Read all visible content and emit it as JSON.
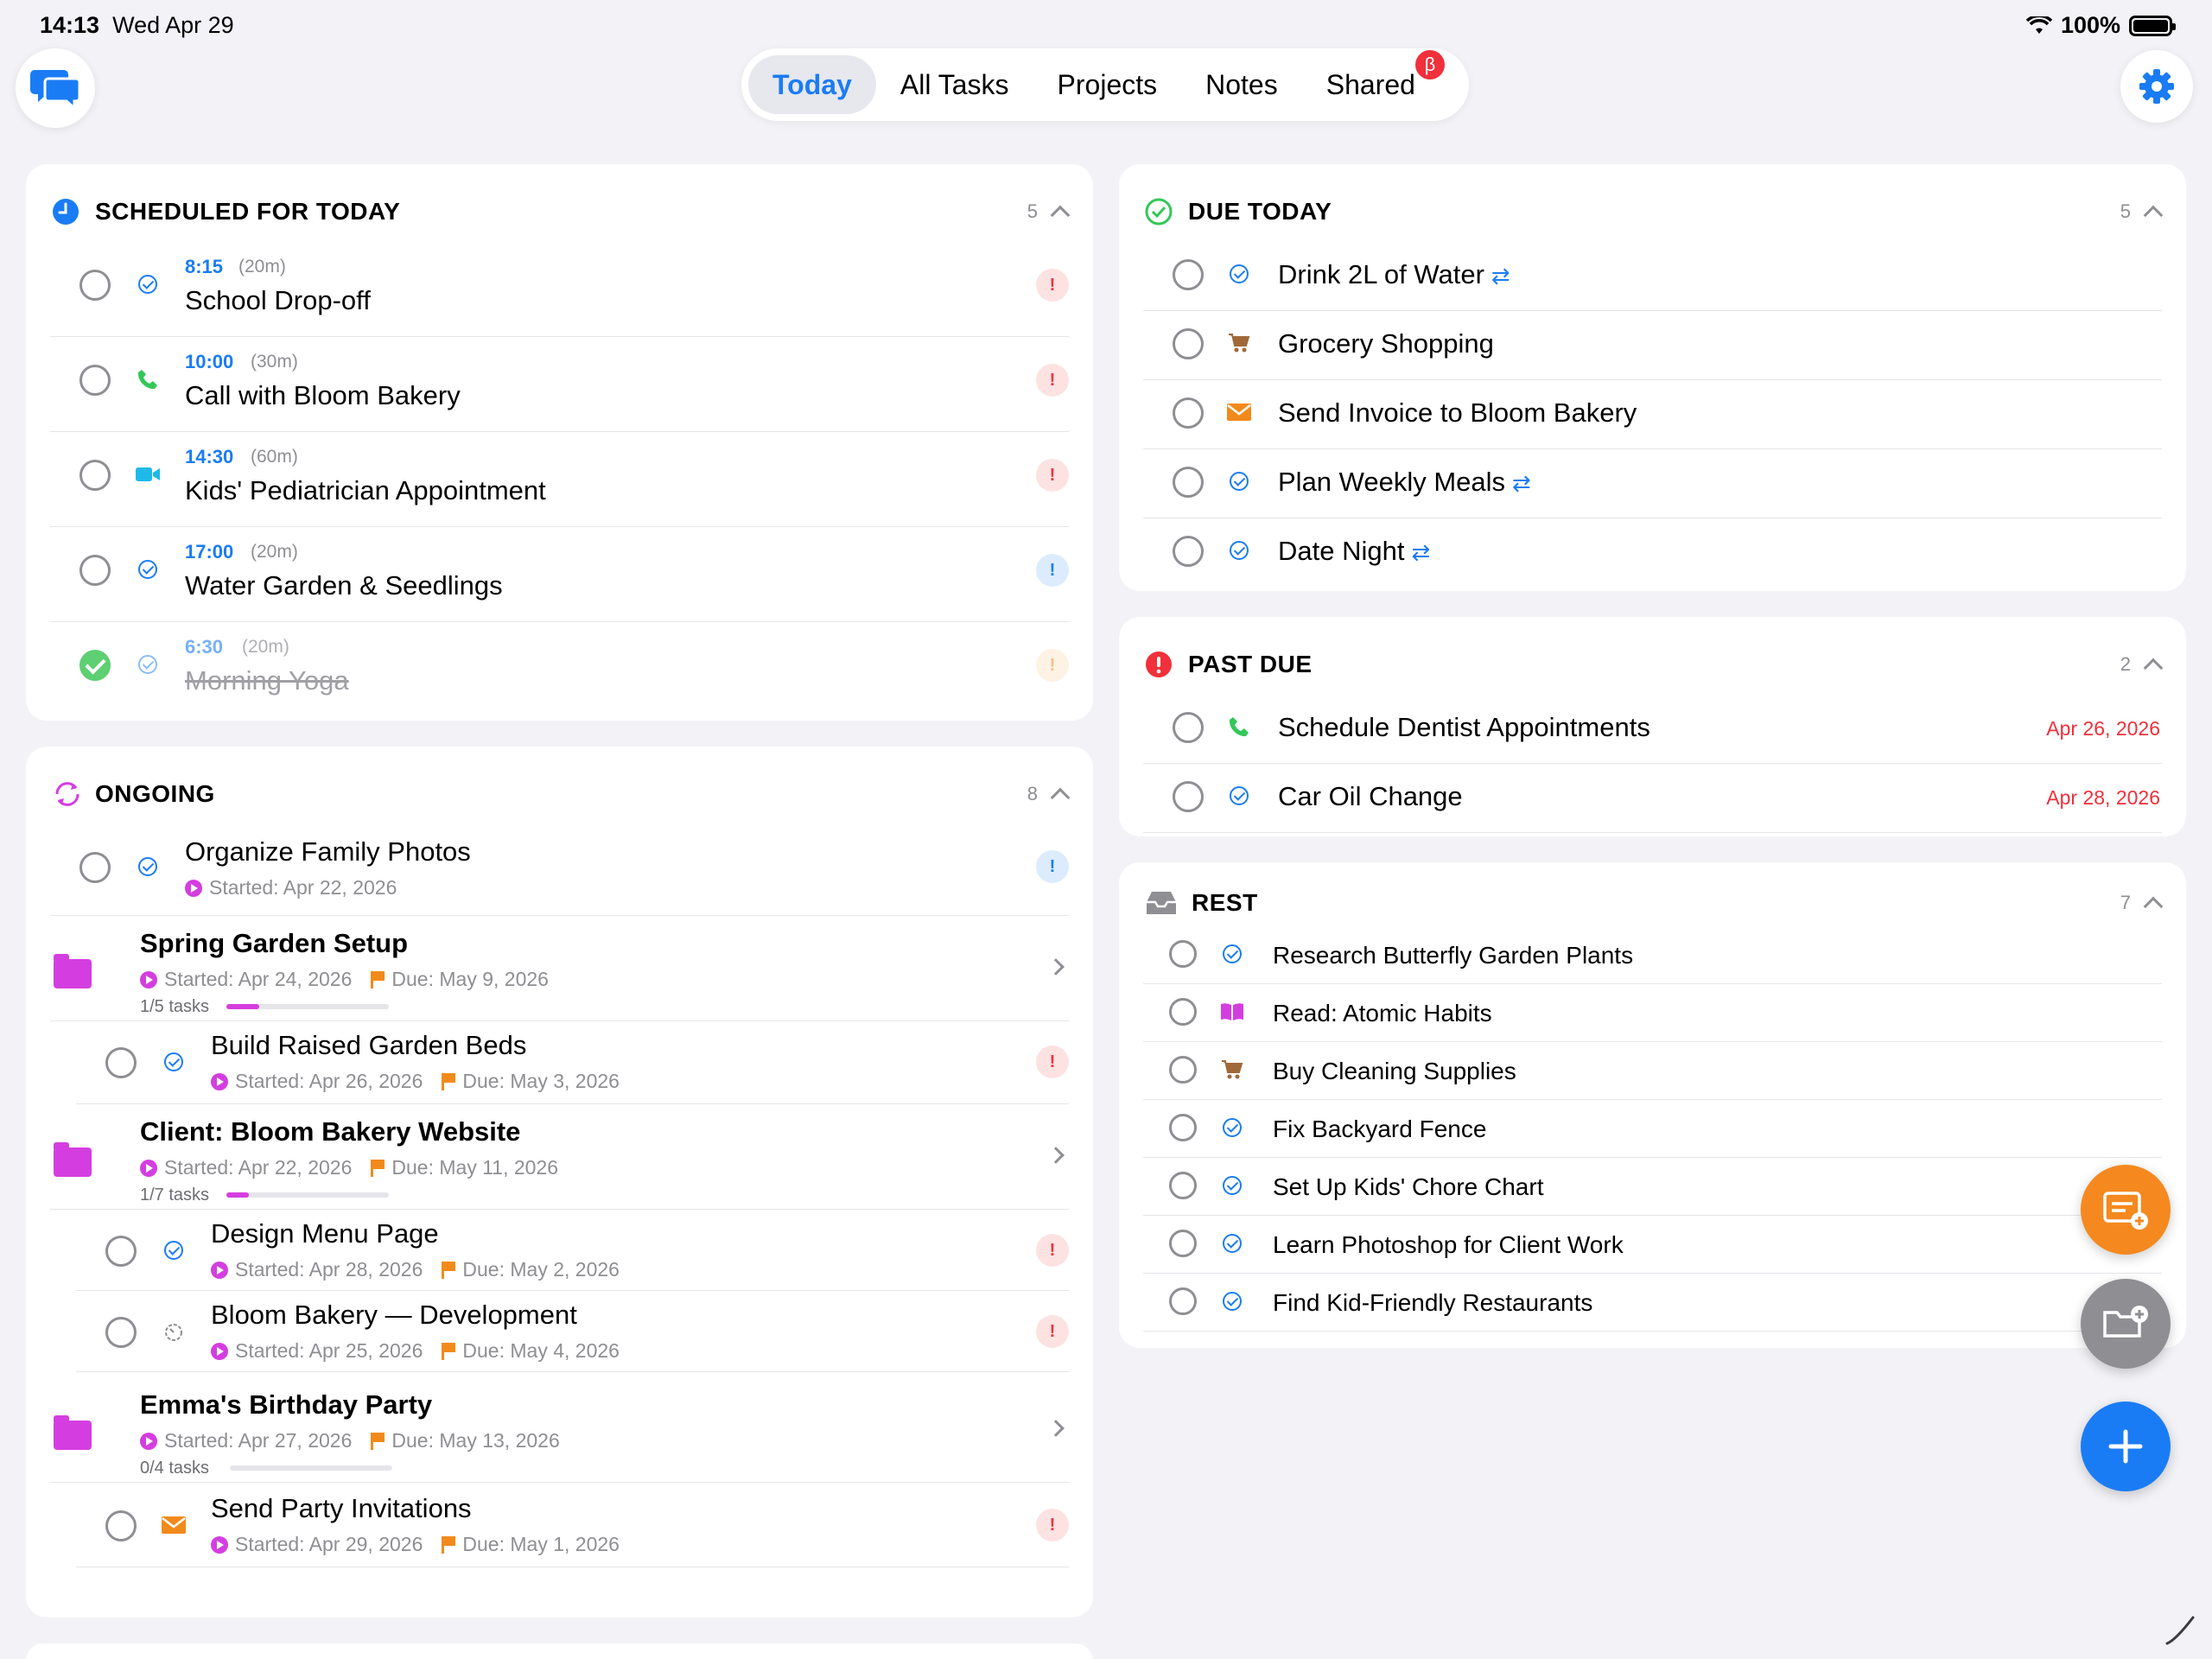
{
  "status": {
    "time": "14:13",
    "date": "Wed Apr 29",
    "battery": "100%"
  },
  "nav": {
    "tabs": [
      {
        "label": "Today"
      },
      {
        "label": "All Tasks"
      },
      {
        "label": "Projects"
      },
      {
        "label": "Notes"
      },
      {
        "label": "Shared",
        "badge": "β"
      }
    ],
    "accent": "#1a7cf5"
  },
  "scheduled": {
    "title": "SCHEDULED FOR TODAY",
    "count": "5",
    "items": [
      {
        "time": "8:15",
        "duration": "(20m)",
        "title": "School Drop-off",
        "icon": "check-circle-icon"
      },
      {
        "time": "10:00",
        "duration": "(30m)",
        "title": "Call with Bloom Bakery",
        "icon": "phone-icon"
      },
      {
        "time": "14:30",
        "duration": "(60m)",
        "title": "Kids' Pediatrician Appointment",
        "icon": "video-icon"
      },
      {
        "time": "17:00",
        "duration": "(20m)",
        "title": "Water Garden & Seedlings",
        "icon": "check-circle-icon"
      },
      {
        "time": "6:30",
        "duration": "(20m)",
        "title": "Morning Yoga",
        "icon": "check-circle-icon",
        "completed": true
      }
    ]
  },
  "ongoing": {
    "title": "ONGOING",
    "count": "8",
    "task1": {
      "title": "Organize Family Photos",
      "started": "Started: Apr 22, 2026"
    },
    "project1": {
      "title": "Spring Garden Setup",
      "started": "Started: Apr 24, 2026",
      "due": "Due: May 9, 2026",
      "progress_text": "1/5 tasks",
      "progress": 0.2
    },
    "task2": {
      "title": "Build Raised Garden Beds",
      "started": "Started: Apr 26, 2026",
      "due": "Due: May 3, 2026"
    },
    "project2": {
      "title": "Client: Bloom Bakery Website",
      "started": "Started: Apr 22, 2026",
      "due": "Due: May 11, 2026",
      "progress_text": "1/7 tasks",
      "progress": 0.14
    },
    "task3": {
      "title": "Design Menu Page",
      "started": "Started: Apr 28, 2026",
      "due": "Due: May 2, 2026"
    },
    "task4": {
      "title": "Bloom Bakery — Development",
      "started": "Started: Apr 25, 2026",
      "due": "Due: May 4, 2026"
    },
    "project3": {
      "title": "Emma's Birthday Party",
      "started": "Started: Apr 27, 2026",
      "due": "Due: May 13, 2026",
      "progress_text": "0/4 tasks",
      "progress": 0
    },
    "task5": {
      "title": "Send Party Invitations",
      "started": "Started: Apr 29, 2026",
      "due": "Due: May 1, 2026"
    }
  },
  "due_today": {
    "title": "DUE TODAY",
    "count": "5",
    "items": [
      {
        "title": "Drink 2L of Water",
        "repeat": true
      },
      {
        "title": "Grocery Shopping"
      },
      {
        "title": "Send Invoice to Bloom Bakery"
      },
      {
        "title": "Plan Weekly Meals",
        "repeat": true
      },
      {
        "title": "Date Night",
        "repeat": true
      }
    ]
  },
  "past_due": {
    "title": "PAST DUE",
    "count": "2",
    "items": [
      {
        "title": "Schedule Dentist Appointments",
        "date": "Apr 26, 2026"
      },
      {
        "title": "Car Oil Change",
        "date": "Apr 28, 2026"
      }
    ]
  },
  "rest": {
    "title": "REST",
    "count": "7",
    "items": [
      {
        "title": "Research Butterfly Garden Plants"
      },
      {
        "title": "Read: Atomic Habits"
      },
      {
        "title": "Buy Cleaning Supplies"
      },
      {
        "title": "Fix Backyard Fence"
      },
      {
        "title": "Set Up Kids' Chore Chart"
      },
      {
        "title": "Learn Photoshop for Client Work"
      },
      {
        "title": "Find Kid-Friendly Restaurants"
      }
    ]
  }
}
